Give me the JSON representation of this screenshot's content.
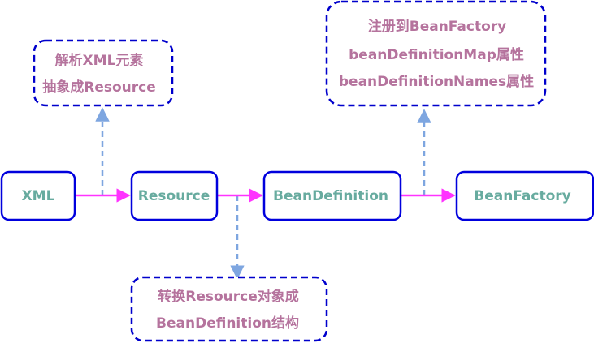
{
  "colors": {
    "node_border": "#0000dd",
    "node_text": "#67ab9f",
    "note_border": "#0000cc",
    "note_text": "#b5739d",
    "flow_arrow": "#ff33ff",
    "dashed_arrow": "#7ea6e0"
  },
  "nodes": {
    "xml": "XML",
    "resource": "Resource",
    "bean_definition": "BeanDefinition",
    "bean_factory": "BeanFactory"
  },
  "notes": {
    "parse": {
      "line1": "解析XML元素",
      "line2": "抽象成Resource"
    },
    "convert": {
      "line1": "转换Resource对象成",
      "line2": "BeanDefinition结构"
    },
    "register": {
      "line1": "注册到BeanFactory",
      "line2": "beanDefinitionMap属性",
      "line3": "beanDefinitionNames属性"
    }
  }
}
